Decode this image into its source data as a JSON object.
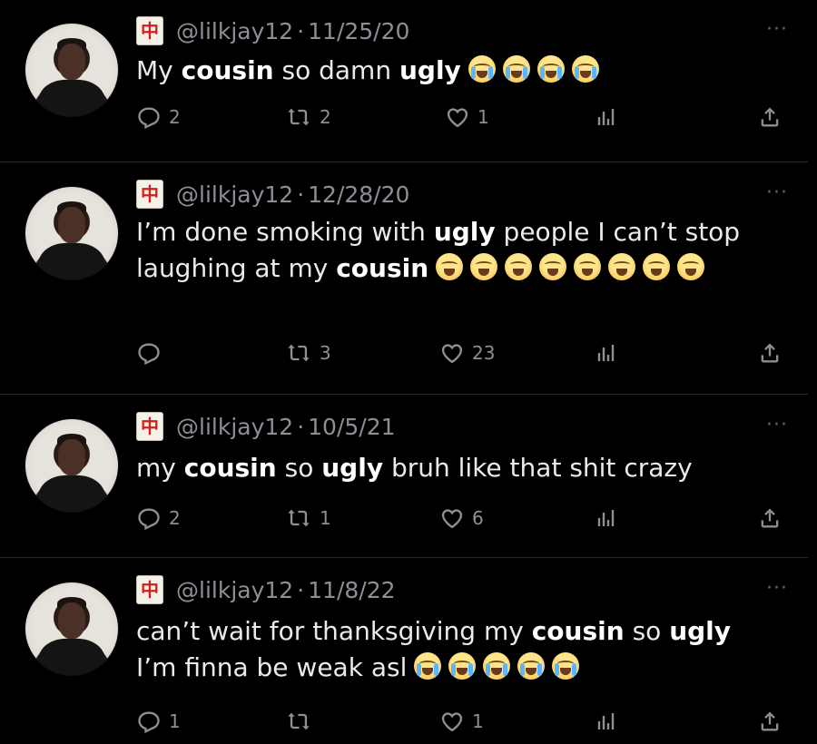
{
  "tweets": [
    {
      "handle": "@lilkjay12",
      "sep": "·",
      "date": "11/25/20",
      "text_html": "My <b>cousin</b> so damn <b>ugly</b>",
      "emoji_count": 4,
      "emoji_type": "cry",
      "replies": "2",
      "retweets": "2",
      "likes": "1"
    },
    {
      "handle": "@lilkjay12",
      "sep": "·",
      "date": "12/28/20",
      "text_html": "I’m done smoking with <b>ugly</b> people I can’t stop laughing at my <b>cousin</b>",
      "emoji_count": 8,
      "emoji_type": "laugh",
      "replies": "",
      "retweets": "3",
      "likes": "23"
    },
    {
      "handle": "@lilkjay12",
      "sep": "·",
      "date": "10/5/21",
      "text_html": "my <b>cousin</b> so <b>ugly</b> bruh like that shit crazy",
      "emoji_count": 0,
      "emoji_type": "",
      "replies": "2",
      "retweets": "1",
      "likes": "6"
    },
    {
      "handle": "@lilkjay12",
      "sep": "·",
      "date": "11/8/22",
      "text_html": "can’t wait for thanksgiving my <b>cousin</b> so <b>ugly</b> I’m finna be weak asl",
      "emoji_count": 5,
      "emoji_type": "cry",
      "replies": "1",
      "retweets": "",
      "likes": "1"
    }
  ],
  "icons": {
    "badge": "mahjong-red-dragon-icon",
    "badge_char": "中",
    "more": "more-dots-icon",
    "reply": "reply-icon",
    "retweet": "retweet-icon",
    "like": "heart-icon",
    "views": "views-bar-icon",
    "share": "share-icon"
  },
  "colors": {
    "background": "#000000",
    "text": "#e9eaeb",
    "muted": "#8b9096",
    "divider": "#2b2e31"
  }
}
